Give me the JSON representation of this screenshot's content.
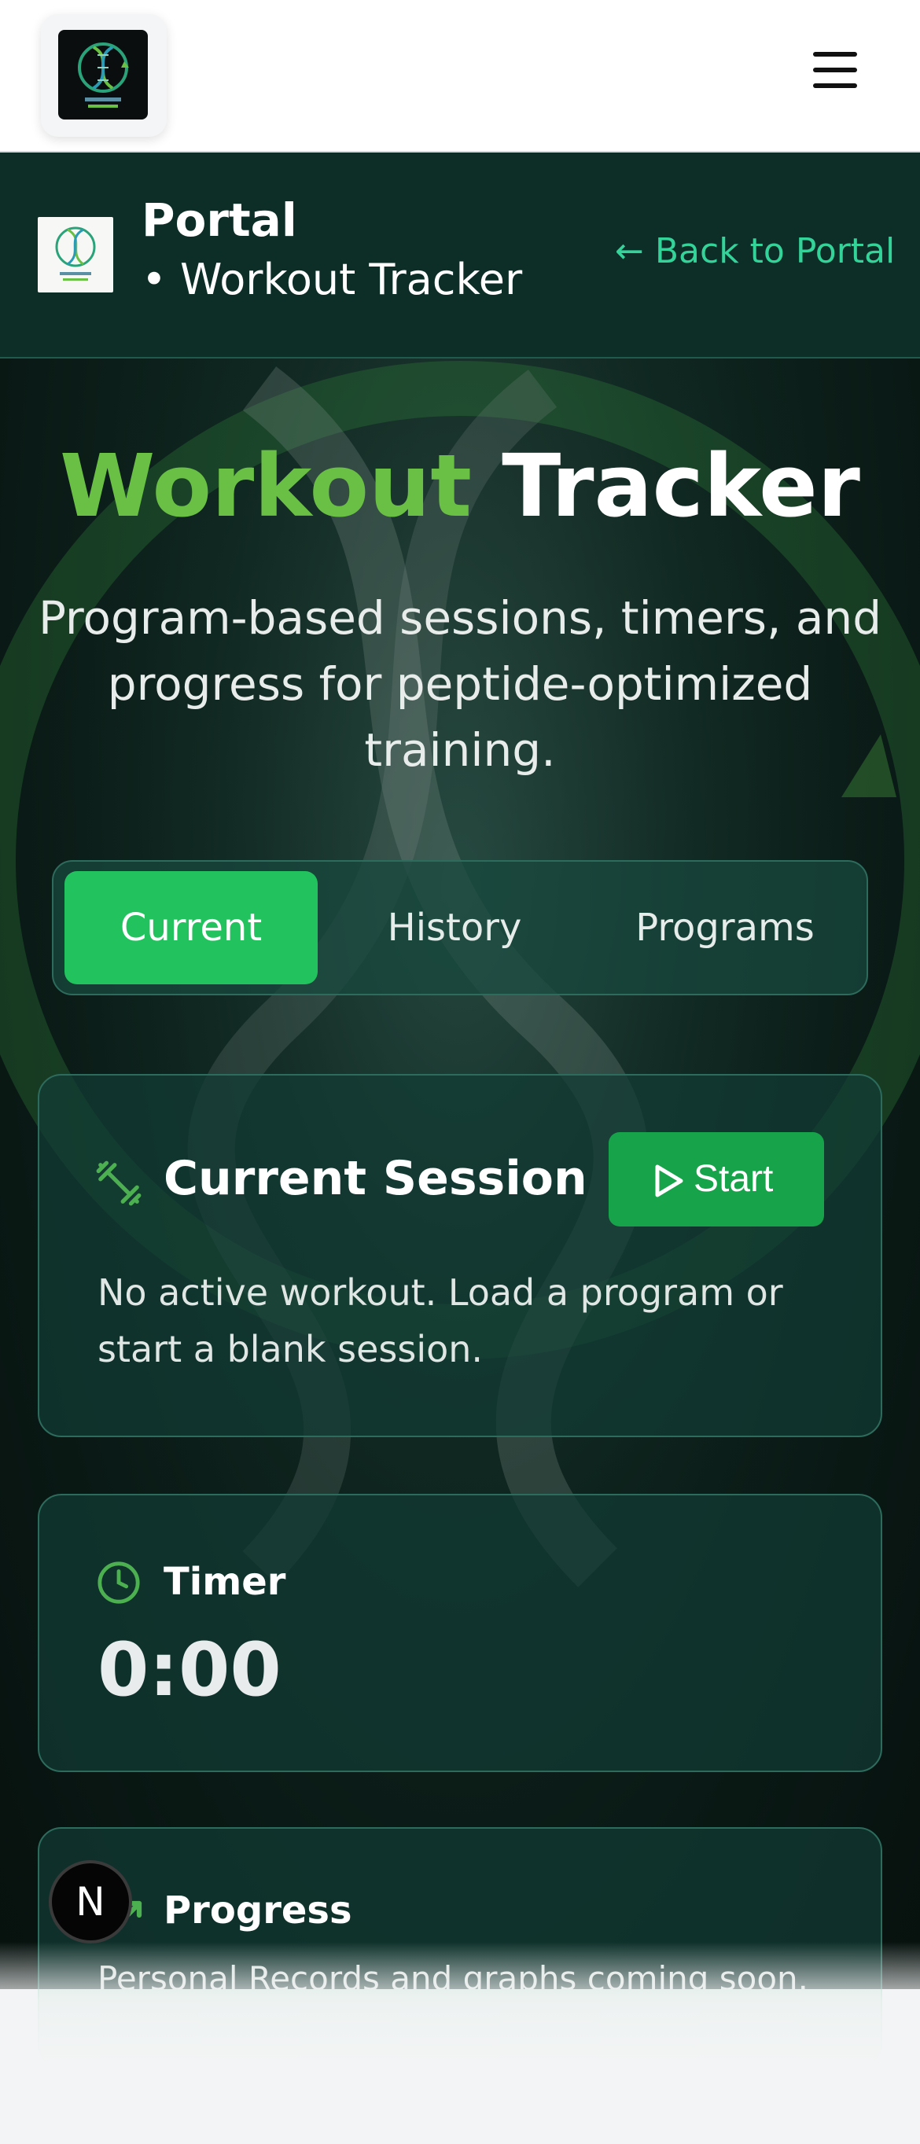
{
  "nav": {
    "logo_icon": "reset-biology-dna-logo",
    "menu_icon": "hamburger-menu-icon"
  },
  "portal": {
    "title": "Portal",
    "subtitle": "• Workout Tracker",
    "back_link": "← Back to Portal"
  },
  "hero": {
    "title_accent": "Workout",
    "title_rest": "Tracker",
    "description": "Program-based sessions, timers, and progress for peptide-optimized training."
  },
  "tabs": [
    {
      "label": "Current",
      "active": true
    },
    {
      "label": "History",
      "active": false
    },
    {
      "label": "Programs",
      "active": false
    }
  ],
  "session": {
    "title": "Current Session",
    "icon": "dumbbell-icon",
    "start_label": "Start",
    "empty_text": "No active workout. Load a program or start a blank session."
  },
  "timer": {
    "label": "Timer",
    "icon": "clock-icon",
    "value": "0:00"
  },
  "progress": {
    "label": "Progress",
    "icon": "trending-up-icon",
    "text": "Personal Records and graphs coming soon."
  },
  "badge": {
    "letter": "N"
  },
  "colors": {
    "accent_green": "#6abf45",
    "button_green": "#22c35e",
    "link_teal": "#34d399",
    "dark_bg": "#0d2d27"
  }
}
